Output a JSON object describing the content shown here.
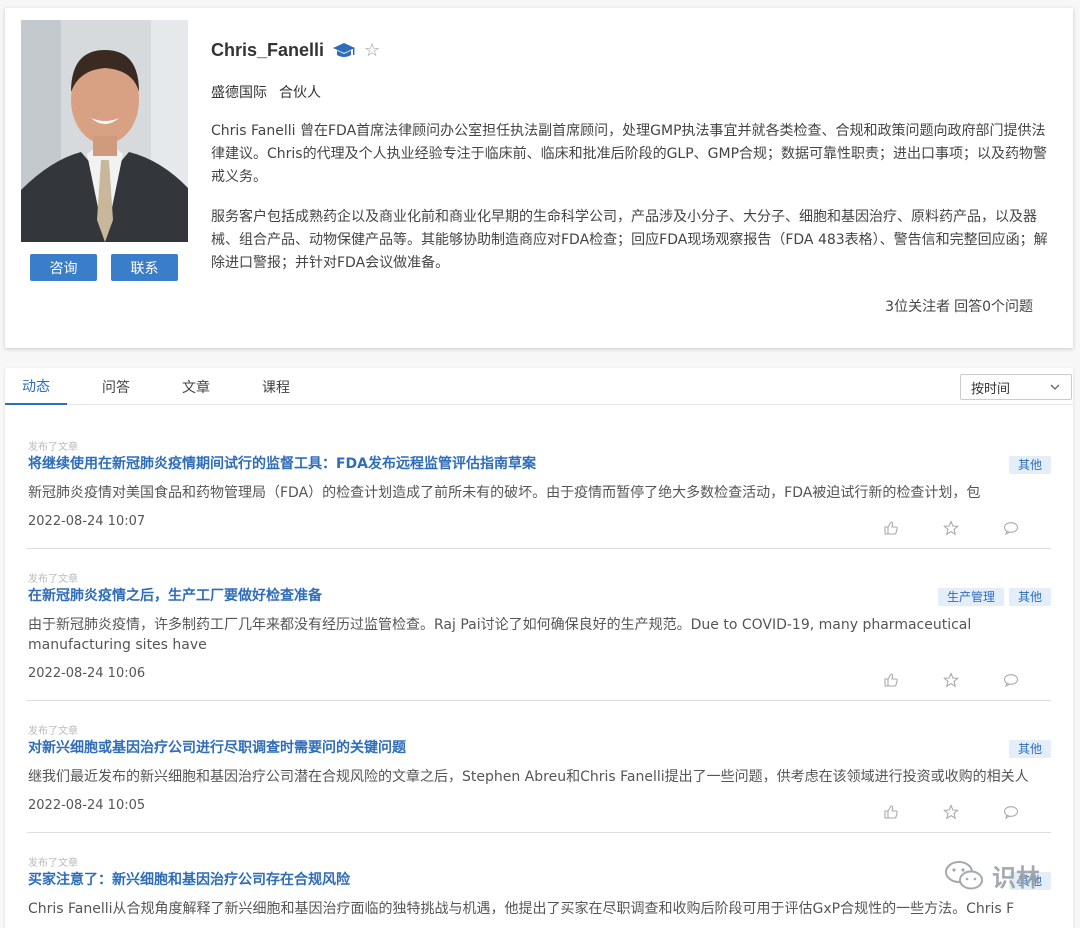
{
  "profile": {
    "name": "Chris_Fanelli",
    "org": "盛德国际",
    "role": "合伙人",
    "bio_paragraphs": [
      "Chris Fanelli 曾在FDA首席法律顾问办公室担任执法副首席顾问，处理GMP执法事宜并就各类检查、合规和政策问题向政府部门提供法律建议。Chris的代理及个人执业经验专注于临床前、临床和批准后阶段的GLP、GMP合规；数据可靠性职责；进出口事项；以及药物警戒义务。",
      "服务客户包括成熟药企以及商业化前和商业化早期的生命科学公司，产品涉及小分子、大分子、细胞和基因治疗、原料药产品，以及器械、组合产品、动物保健产品等。其能够协助制造商应对FDA检查；回应FDA现场观察报告（FDA 483表格）、警告信和完整回应函；解除进口警报；并针对FDA会议做准备。"
    ],
    "followers": "3位关注者",
    "answers": "回答0个问题",
    "buttons": {
      "consult": "咨询",
      "contact": "联系"
    }
  },
  "feed": {
    "tabs": [
      "动态",
      "问答",
      "文章",
      "课程"
    ],
    "active_tab": "动态",
    "sort": "按时间",
    "items": [
      {
        "kind": "发布了文章",
        "title": "将继续使用在新冠肺炎疫情期间试行的监督工具：FDA发布远程监管评估指南草案",
        "tags": [
          "其他"
        ],
        "excerpt": "新冠肺炎疫情对美国食品和药物管理局（FDA）的检查计划造成了前所未有的破坏。由于疫情而暂停了绝大多数检查活动，FDA被迫试行新的检查计划，包",
        "date": "2022-08-24 10:07"
      },
      {
        "kind": "发布了文章",
        "title": "在新冠肺炎疫情之后，生产工厂要做好检查准备",
        "tags": [
          "生产管理",
          "其他"
        ],
        "excerpt": "由于新冠肺炎疫情，许多制药工厂几年来都没有经历过监管检查。Raj Pai讨论了如何确保良好的生产规范。Due to COVID-19, many pharmaceutical manufacturing sites have",
        "date": "2022-08-24 10:06"
      },
      {
        "kind": "发布了文章",
        "title": "对新兴细胞或基因治疗公司进行尽职调查时需要问的关键问题",
        "tags": [
          "其他"
        ],
        "excerpt": "继我们最近发布的新兴细胞和基因治疗公司潜在合规风险的文章之后，Stephen Abreu和Chris Fanelli提出了一些问题，供考虑在该领域进行投资或收购的相关人",
        "date": "2022-08-24 10:05"
      },
      {
        "kind": "发布了文章",
        "title": "买家注意了：新兴细胞和基因治疗公司存在合规风险",
        "tags": [
          "其他"
        ],
        "excerpt": "Chris Fanelli从合规角度解释了新兴细胞和基因治疗面临的独特挑战与机遇，他提出了买家在尽职调查和收购后阶段可用于评估GxP合规性的一些方法。Chris F",
        "date": ""
      }
    ]
  },
  "watermark": "识林",
  "colors": {
    "accent": "#2f6db8",
    "button": "#3a7dc9",
    "tag_bg": "#e3eef9"
  }
}
